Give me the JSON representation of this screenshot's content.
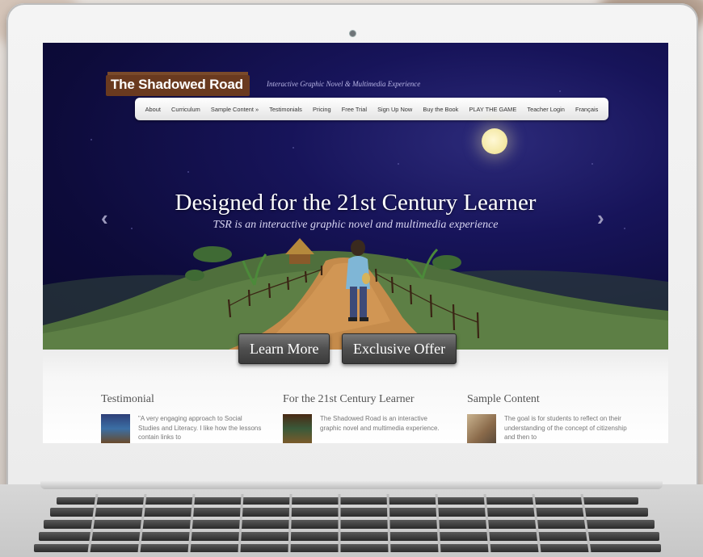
{
  "site": {
    "logo": "The Shadowed Road",
    "tagline": "Interactive Graphic Novel & Multimedia Experience"
  },
  "nav": {
    "items": [
      "About",
      "Curriculum",
      "Sample Content »",
      "Testimonials",
      "Pricing",
      "Free Trial",
      "Sign Up Now",
      "Buy the Book",
      "PLAY THE GAME",
      "Teacher Login",
      "Français"
    ]
  },
  "hero": {
    "title": "Designed for the 21st Century Learner",
    "subtitle": "TSR is an interactive graphic novel and multimedia experience",
    "prev_icon": "‹",
    "next_icon": "›",
    "btn_learn_more": "Learn More",
    "btn_exclusive_offer": "Exclusive Offer"
  },
  "columns": [
    {
      "heading": "Testimonial",
      "text": "\"A very engaging approach to Social Studies and Literacy. I like how the lessons contain links to"
    },
    {
      "heading": "For the 21st Century Learner",
      "text": "The Shadowed Road is an interactive graphic novel and multimedia experience."
    },
    {
      "heading": "Sample Content",
      "text": "The goal is for students to reflect on their understanding of the concept of citizenship and then to"
    }
  ],
  "colors": {
    "sky": "#0f0c3e",
    "hill": "#4f6f3c",
    "path": "#c58b4b",
    "logo_bg": "#6a3a1f"
  }
}
